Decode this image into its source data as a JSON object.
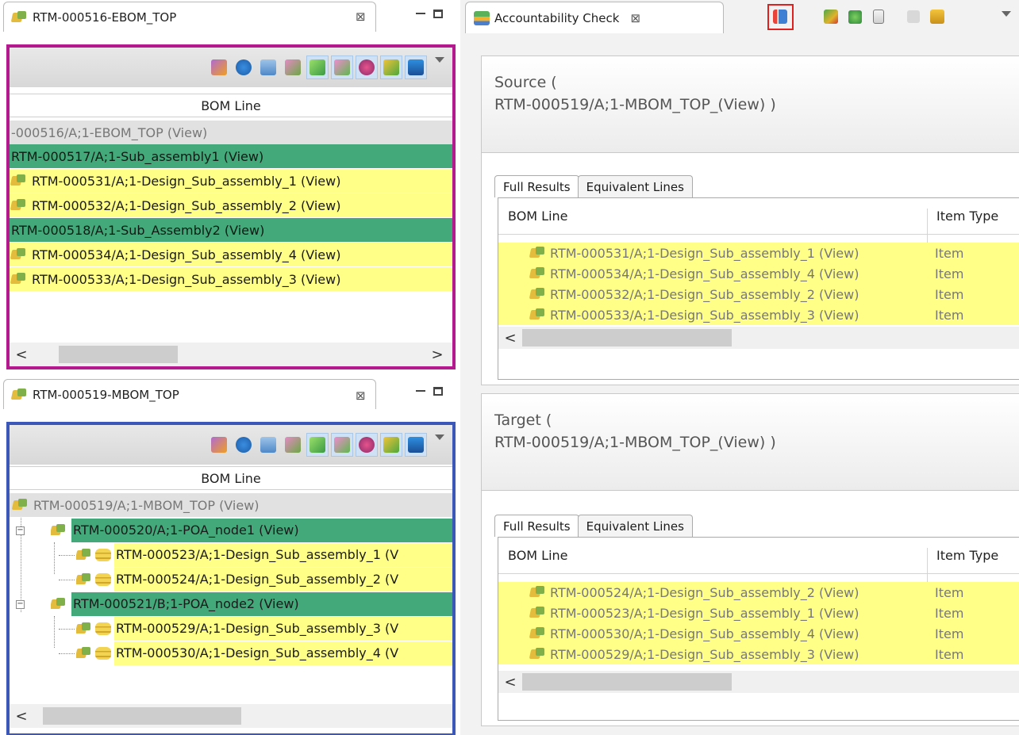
{
  "ebom_panel": {
    "tab_title": "RTM-000516-EBOM_TOP",
    "close_symbol": "⊠",
    "border_color": "#b5198e",
    "column_header": "BOM Line",
    "rows": [
      {
        "text": "-000516/A;1-EBOM_TOP (View)",
        "style": "gray"
      },
      {
        "text": "RTM-000517/A;1-Sub_assembly1 (View)",
        "style": "green"
      },
      {
        "text": "RTM-000531/A;1-Design_Sub_assembly_1 (View)",
        "style": "yellow"
      },
      {
        "text": "RTM-000532/A;1-Design_Sub_assembly_2 (View)",
        "style": "yellow"
      },
      {
        "text": "RTM-000518/A;1-Sub_Assembly2 (View)",
        "style": "green"
      },
      {
        "text": "RTM-000534/A;1-Design_Sub_assembly_4 (View)",
        "style": "yellow"
      },
      {
        "text": "RTM-000533/A;1-Design_Sub_assembly_3 (View)",
        "style": "yellow"
      }
    ],
    "scroll_left": "<",
    "scroll_right": ">"
  },
  "mbom_panel": {
    "tab_title": "RTM-000519-MBOM_TOP",
    "close_symbol": "⊠",
    "border_color": "#3b57b8",
    "column_header": "BOM Line",
    "rows": [
      {
        "text": "RTM-000519/A;1-MBOM_TOP (View)",
        "style": "gray"
      },
      {
        "text": "RTM-000520/A;1-POA_node1 (View)",
        "style": "green",
        "expander": "−"
      },
      {
        "text": "RTM-000523/A;1-Design_Sub_assembly_1 (V",
        "style": "yellow"
      },
      {
        "text": "RTM-000524/A;1-Design_Sub_assembly_2 (V",
        "style": "yellow"
      },
      {
        "text": "RTM-000521/B;1-POA_node2 (View)",
        "style": "green",
        "expander": "−"
      },
      {
        "text": "RTM-000529/A;1-Design_Sub_assembly_3 (V",
        "style": "yellow"
      },
      {
        "text": "RTM-000530/A;1-Design_Sub_assembly_4 (V",
        "style": "yellow"
      }
    ],
    "scroll_left": "<"
  },
  "accountability": {
    "tab_title": "Accountability Check",
    "close_symbol": "⊠",
    "highlight_color": "#e0201d",
    "source": {
      "label": "Source (",
      "value": "RTM-000519/A;1-MBOM_TOP_(View) )",
      "tabs": [
        "Full Results",
        "Equivalent Lines"
      ],
      "columns": [
        "BOM Line",
        "Item Type"
      ],
      "rows": [
        {
          "name": "RTM-000531/A;1-Design_Sub_assembly_1 (View)",
          "type": "Item"
        },
        {
          "name": "RTM-000534/A;1-Design_Sub_assembly_4 (View)",
          "type": "Item"
        },
        {
          "name": "RTM-000532/A;1-Design_Sub_assembly_2 (View)",
          "type": "Item"
        },
        {
          "name": "RTM-000533/A;1-Design_Sub_assembly_3 (View)",
          "type": "Item"
        }
      ]
    },
    "target": {
      "label": "Target (",
      "value": "RTM-000519/A;1-MBOM_TOP_(View) )",
      "tabs": [
        "Full Results",
        "Equivalent Lines"
      ],
      "columns": [
        "BOM Line",
        "Item Type"
      ],
      "rows": [
        {
          "name": "RTM-000524/A;1-Design_Sub_assembly_2 (View)",
          "type": "Item"
        },
        {
          "name": "RTM-000523/A;1-Design_Sub_assembly_1 (View)",
          "type": "Item"
        },
        {
          "name": "RTM-000530/A;1-Design_Sub_assembly_4 (View)",
          "type": "Item"
        },
        {
          "name": "RTM-000529/A;1-Design_Sub_assembly_3 (View)",
          "type": "Item"
        }
      ]
    },
    "scroll_left": "<"
  }
}
